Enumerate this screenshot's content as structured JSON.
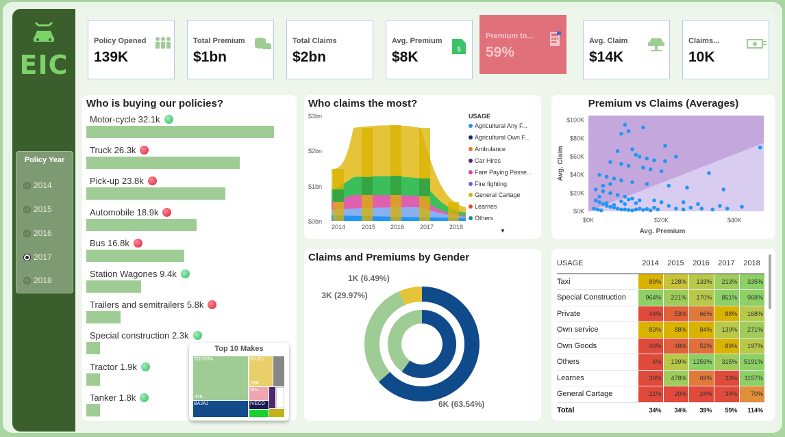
{
  "logo_text": "EIC",
  "slicer": {
    "title": "Policy Year",
    "items": [
      "2014",
      "2015",
      "2016",
      "2017",
      "2018"
    ],
    "selected": "2017"
  },
  "kpis": [
    {
      "label": "Policy Opened",
      "value": "139K",
      "icon": "people-icon"
    },
    {
      "label": "Total Premium",
      "value": "$1bn",
      "icon": "coins-icon"
    },
    {
      "label": "Total Claims",
      "value": "$2bn",
      "icon": ""
    },
    {
      "label": "Avg. Premium",
      "value": "$8K",
      "icon": "document-money-icon"
    },
    {
      "label": "Premium to...",
      "value": "59%",
      "icon": "calculator-icon"
    },
    {
      "label": "Avg. Claim",
      "value": "$14K",
      "icon": "car-lift-icon"
    },
    {
      "label": "Claims...",
      "value": "10K",
      "icon": "cash-icon"
    }
  ],
  "buyers": {
    "title": "Who is buying our policies?",
    "rows": [
      {
        "label": "Motor-cycle 32.1k",
        "value": 32.1,
        "status": "up"
      },
      {
        "label": "Truck 26.3k",
        "value": 26.3,
        "status": "down"
      },
      {
        "label": "Pick-up 23.8k",
        "value": 23.8,
        "status": "down"
      },
      {
        "label": "Automobile 18.9k",
        "value": 18.9,
        "status": "down"
      },
      {
        "label": "Bus 16.8k",
        "value": 16.8,
        "status": "down"
      },
      {
        "label": "Station Wagones 9.4k",
        "value": 9.4,
        "status": "up"
      },
      {
        "label": "Trailers and semitrailers 5.8k",
        "value": 5.8,
        "status": "down"
      },
      {
        "label": "Special construction 2.3k",
        "value": 2.3,
        "status": "up"
      },
      {
        "label": "Tractor 1.9k",
        "value": 1.9,
        "status": "up"
      },
      {
        "label": "Tanker 1.8k",
        "value": 1.8,
        "status": "up"
      }
    ]
  },
  "treemap": {
    "title": "Top 10 Makes",
    "cells": [
      {
        "label": "TOYOTA",
        "sublabel": "44K",
        "color": "#9fcc94"
      },
      {
        "label": "ISUZU",
        "sublabel": "18K",
        "color": "#e8cf6a"
      },
      {
        "label": "",
        "sublabel": "",
        "color": "#888888"
      },
      {
        "label": "SIN...",
        "sublabel": "",
        "color": "#f0a6b0"
      },
      {
        "label": "",
        "sublabel": "",
        "color": "#4a2a6a"
      },
      {
        "label": "",
        "sublabel": "",
        "color": "#ffffff"
      },
      {
        "label": "BAJAJ",
        "sublabel": "",
        "color": "#124a8a"
      },
      {
        "label": "IVECO",
        "sublabel": "",
        "color": "#1c1c50"
      },
      {
        "label": "",
        "sublabel": "",
        "color": "#18d22a"
      },
      {
        "label": "",
        "sublabel": "",
        "color": "#c4b018"
      }
    ]
  },
  "claims_stream": {
    "title": "Who claims the most?",
    "y_ticks": [
      "$3bn",
      "$2bn",
      "$1bn",
      "$0bn"
    ],
    "x_ticks": [
      "2014",
      "2015",
      "2016",
      "2017",
      "2018"
    ],
    "legend_title": "USAGE",
    "legend": [
      {
        "label": "Agricultural Any F...",
        "color": "#2196f3"
      },
      {
        "label": "Agricultural Own F...",
        "color": "#0d2a7a"
      },
      {
        "label": "Ambulance",
        "color": "#f07030"
      },
      {
        "label": "Car Hires",
        "color": "#5a1a80"
      },
      {
        "label": "Fare Paying Passe...",
        "color": "#e040a0"
      },
      {
        "label": "Fire fighting",
        "color": "#7a5ae0"
      },
      {
        "label": "General Cartage",
        "color": "#d9b300"
      },
      {
        "label": "Learnes",
        "color": "#e04a3a"
      },
      {
        "label": "Others",
        "color": "#1a8a8a"
      }
    ]
  },
  "chart_data": {
    "type": "scatter",
    "title": "Premium vs Claims (Averages)",
    "xlabel": "Avg. Premium",
    "ylabel": "Avg. Claim",
    "x_ticks": [
      "$0K",
      "$20K",
      "$40K"
    ],
    "y_ticks": [
      "$100K",
      "$80K",
      "$60K",
      "$40K",
      "$20K",
      "$0K"
    ],
    "xlim": [
      0,
      48000
    ],
    "ylim": [
      0,
      105000
    ],
    "points": [
      [
        10000,
        95000
      ],
      [
        11000,
        88000
      ],
      [
        15000,
        92000
      ],
      [
        9000,
        85000
      ],
      [
        21000,
        72000
      ],
      [
        47000,
        70000
      ],
      [
        12000,
        68000
      ],
      [
        8000,
        66000
      ],
      [
        13000,
        62000
      ],
      [
        14000,
        60000
      ],
      [
        16000,
        58000
      ],
      [
        24000,
        60000
      ],
      [
        21000,
        55000
      ],
      [
        18000,
        56000
      ],
      [
        6000,
        54000
      ],
      [
        9000,
        52000
      ],
      [
        11000,
        50000
      ],
      [
        15000,
        48000
      ],
      [
        17000,
        46000
      ],
      [
        20000,
        44000
      ],
      [
        33000,
        42000
      ],
      [
        3000,
        40000
      ],
      [
        5000,
        38000
      ],
      [
        7000,
        36000
      ],
      [
        9000,
        34000
      ],
      [
        12000,
        32000
      ],
      [
        16000,
        30000
      ],
      [
        22000,
        28000
      ],
      [
        27000,
        26000
      ],
      [
        37000,
        24000
      ],
      [
        2000,
        24000
      ],
      [
        4000,
        22000
      ],
      [
        6000,
        20000
      ],
      [
        8000,
        18000
      ],
      [
        10000,
        16000
      ],
      [
        12000,
        14000
      ],
      [
        14000,
        12000
      ],
      [
        18000,
        12000
      ],
      [
        20000,
        10000
      ],
      [
        26000,
        10000
      ],
      [
        30000,
        8000
      ],
      [
        36000,
        6000
      ],
      [
        42000,
        5000
      ],
      [
        2000,
        12000
      ],
      [
        3000,
        10000
      ],
      [
        4000,
        8000
      ],
      [
        5000,
        6000
      ],
      [
        6000,
        5000
      ],
      [
        7000,
        4000
      ],
      [
        8000,
        3000
      ],
      [
        9000,
        2000
      ],
      [
        10000,
        2000
      ],
      [
        11000,
        1500
      ],
      [
        12000,
        1000
      ],
      [
        13000,
        2000
      ],
      [
        14000,
        3000
      ],
      [
        15000,
        1500
      ],
      [
        16000,
        2500
      ],
      [
        17000,
        1000
      ],
      [
        19000,
        2000
      ],
      [
        1500,
        3000
      ],
      [
        2500,
        2000
      ],
      [
        3500,
        1000
      ],
      [
        5000,
        9000
      ],
      [
        7000,
        7000
      ],
      [
        9000,
        11000
      ],
      [
        11000,
        13000
      ],
      [
        13000,
        9000
      ],
      [
        3000,
        16000
      ],
      [
        4000,
        28000
      ],
      [
        6000,
        30000
      ],
      [
        10000,
        8000
      ],
      [
        18000,
        4000
      ],
      [
        22000,
        6000
      ],
      [
        24000,
        3000
      ],
      [
        26000,
        2000
      ],
      [
        28000,
        4000
      ],
      [
        31000,
        3000
      ],
      [
        34000,
        2000
      ],
      [
        38000,
        3000
      ]
    ]
  },
  "gender": {
    "title": "Claims and Premiums by Gender",
    "slices": [
      {
        "label": "6K (63.54%)",
        "value": 63.54,
        "color": "#0f4a8a"
      },
      {
        "label": "3K (29.97%)",
        "value": 29.97,
        "color": "#9fcc94"
      },
      {
        "label": "1K (6.49%)",
        "value": 6.49,
        "color": "#e6c43a"
      }
    ]
  },
  "matrix": {
    "header": "USAGE",
    "years": [
      "2014",
      "2015",
      "2016",
      "2017",
      "2018"
    ],
    "rows": [
      {
        "label": "Taxi",
        "cells": [
          "89%",
          "128%",
          "133%",
          "213%",
          "335%"
        ],
        "colors": [
          "#d9b300",
          "#c9c33a",
          "#b8c94a",
          "#9fcc5a",
          "#8cd066"
        ]
      },
      {
        "label": "Special Construction",
        "cells": [
          "964%",
          "221%",
          "170%",
          "851%",
          "968%"
        ],
        "colors": [
          "#8cd066",
          "#9fcc5a",
          "#b8c94a",
          "#8cd066",
          "#8cd066"
        ]
      },
      {
        "label": "Private",
        "cells": [
          "44%",
          "53%",
          "66%",
          "88%",
          "168%"
        ],
        "colors": [
          "#e04a3a",
          "#e0603a",
          "#e07a3a",
          "#d9b300",
          "#b8c94a"
        ]
      },
      {
        "label": "Own service",
        "cells": [
          "83%",
          "88%",
          "84%",
          "139%",
          "271%"
        ],
        "colors": [
          "#d9b300",
          "#d9b300",
          "#d9b300",
          "#b8c94a",
          "#9fcc5a"
        ]
      },
      {
        "label": "Own Goods",
        "cells": [
          "40%",
          "48%",
          "52%",
          "89%",
          "197%"
        ],
        "colors": [
          "#e04a3a",
          "#e0603a",
          "#e0703a",
          "#d9b300",
          "#b8c94a"
        ]
      },
      {
        "label": "Others",
        "cells": [
          "6%",
          "139%",
          "1259%",
          "315%",
          "5191%"
        ],
        "colors": [
          "#e04a3a",
          "#b8c94a",
          "#8cd066",
          "#9fcc5a",
          "#8cd066"
        ]
      },
      {
        "label": "Learnes",
        "cells": [
          "39%",
          "478%",
          "69%",
          "33%",
          "1157%"
        ],
        "colors": [
          "#e04a3a",
          "#9fcc5a",
          "#e07a3a",
          "#e04a3a",
          "#8cd066"
        ]
      },
      {
        "label": "General Cartage",
        "cells": [
          "21%",
          "20%",
          "24%",
          "34%",
          "70%"
        ],
        "colors": [
          "#e04a3a",
          "#e04a3a",
          "#e04a3a",
          "#e04a3a",
          "#e0903a"
        ]
      }
    ],
    "total_label": "Total",
    "totals": [
      "34%",
      "34%",
      "39%",
      "59%",
      "114%"
    ]
  }
}
